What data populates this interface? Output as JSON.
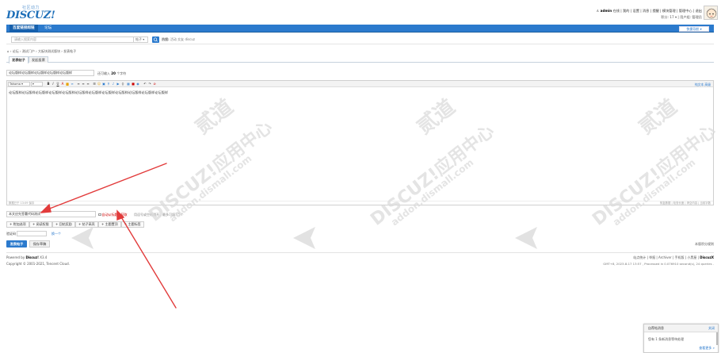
{
  "logo": {
    "slogan": "社区动力",
    "word": "DISCUZ!"
  },
  "userbar": {
    "user": "admin",
    "items": [
      "在线",
      "我的",
      "设置",
      "消息",
      "提醒",
      "模块管理",
      "管理中心",
      "退出"
    ],
    "credits": "积分: 17",
    "group": "用户组: 管理员"
  },
  "nav": {
    "items": [
      "百度链接超链",
      "论坛"
    ],
    "quick": "快捷导航"
  },
  "search": {
    "placeholder": "请输入搜索内容",
    "type": "帖子",
    "hot_label": "热搜:",
    "hot_words": [
      "活动",
      "交友",
      "discuz"
    ]
  },
  "breadcrumb": [
    "论坛",
    "测试门户",
    "大板块测试版块",
    "发表帖子"
  ],
  "tabs": [
    "发表帖子",
    "发起投票"
  ],
  "subject": {
    "value": "论坛版样论坛版样论坛版样论坛版样论坛版样",
    "hint_prefix": "还可输入",
    "hint_count": "20",
    "hint_suffix": "个字符"
  },
  "editor": {
    "font": "Tahoma",
    "size": "",
    "mode_label": "纯文本",
    "advanced_label": "高级",
    "body": "论坛版样论坛版样论坛版样论坛版样论坛版样论坛版样论坛版样论坛版样论坛版样论坛版样论坛版样论坛版样",
    "autosave": "数据已于 13:09 保存",
    "footer_right": "恢复数据 | 检查长度 | 清空内容 | 当前字数"
  },
  "tags": {
    "value": "本文应先签署代码测试",
    "suggest": "自动从标题中获取",
    "hint": "用逗号或空格隔开，最多可填写5个"
  },
  "options": [
    "附加选项",
    "阅读权限",
    "回帖奖励",
    "帖子高亮",
    "主题置顶",
    "主题标签"
  ],
  "captcha": {
    "label": "验证码",
    "change": "换一个"
  },
  "buttons": {
    "submit": "发表帖子",
    "draft": "保存草稿"
  },
  "rules": "本版积分规则",
  "footer": {
    "powered_prefix": "Powered by",
    "powered_name": "Discuz!",
    "powered_version": "X3.4",
    "copyright": "Copyright © 2001-2021, Tencent Cloud.",
    "links": [
      "站点统计",
      "举报",
      "Archiver",
      "手机版",
      "小黑屋"
    ],
    "links_brand": "DiscuzX",
    "gmt": "GMT+8, 2023-8-17 13:57 , Processed in 0.076910 second(s), 24 queries ."
  },
  "popup": {
    "title": "自荐帖消息",
    "close": "关闭",
    "body": "您有 1 条新消息等待处理",
    "more": "查看更多"
  },
  "watermark": {
    "brand": "DISCUZ!应用中心",
    "domain": "addon.dismall.com",
    "mark": "贰道"
  },
  "colors": {
    "accent": "#2b7acd",
    "annotation": "#e23b3b"
  }
}
